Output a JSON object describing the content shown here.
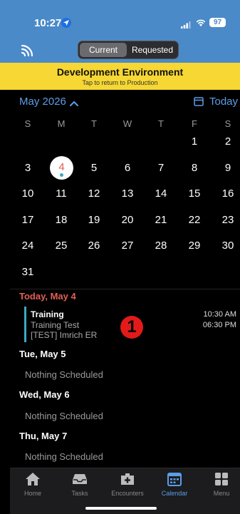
{
  "status_bar": {
    "time": "10:27",
    "battery": "97"
  },
  "header": {
    "segments": [
      "Current",
      "Requested"
    ],
    "active_segment": "Current"
  },
  "banner": {
    "title": "Development Environment",
    "subtitle": "Tap to return to Production"
  },
  "calendar": {
    "month_label": "May 2026",
    "today_label": "Today",
    "weekdays": [
      "S",
      "M",
      "T",
      "W",
      "T",
      "F",
      "S"
    ],
    "weeks": [
      [
        "",
        "",
        "",
        "",
        "",
        "1",
        "2"
      ],
      [
        "3",
        "4",
        "5",
        "6",
        "7",
        "8",
        "9"
      ],
      [
        "10",
        "11",
        "12",
        "13",
        "14",
        "15",
        "16"
      ],
      [
        "17",
        "18",
        "19",
        "20",
        "21",
        "22",
        "23"
      ],
      [
        "24",
        "25",
        "26",
        "27",
        "28",
        "29",
        "30"
      ],
      [
        "31",
        "",
        "",
        "",
        "",
        "",
        ""
      ]
    ],
    "selected_day": "4"
  },
  "agenda": {
    "today_header": "Today, May 4",
    "event": {
      "title": "Training",
      "line1": "Training Test",
      "line2": "[TEST] Imrich ER",
      "start": "10:30 AM",
      "end": "06:30 PM",
      "badge": "1"
    },
    "days": [
      {
        "date": "Tue, May 5",
        "text": "Nothing Scheduled"
      },
      {
        "date": "Wed, May 6",
        "text": "Nothing Scheduled"
      },
      {
        "date": "Thu, May 7",
        "text": "Nothing Scheduled"
      }
    ]
  },
  "tabbar": {
    "items": [
      {
        "label": "Home",
        "icon": "home-icon"
      },
      {
        "label": "Tasks",
        "icon": "inbox-icon"
      },
      {
        "label": "Encounters",
        "icon": "medical-bag-icon"
      },
      {
        "label": "Calendar",
        "icon": "calendar-icon"
      },
      {
        "label": "Menu",
        "icon": "grid-icon"
      }
    ],
    "active": "Calendar"
  },
  "colors": {
    "accent": "#5a9ee8",
    "today": "#e06055",
    "banner": "#f6d733",
    "header": "#4a8ac8",
    "event": "#3aa9c8"
  }
}
